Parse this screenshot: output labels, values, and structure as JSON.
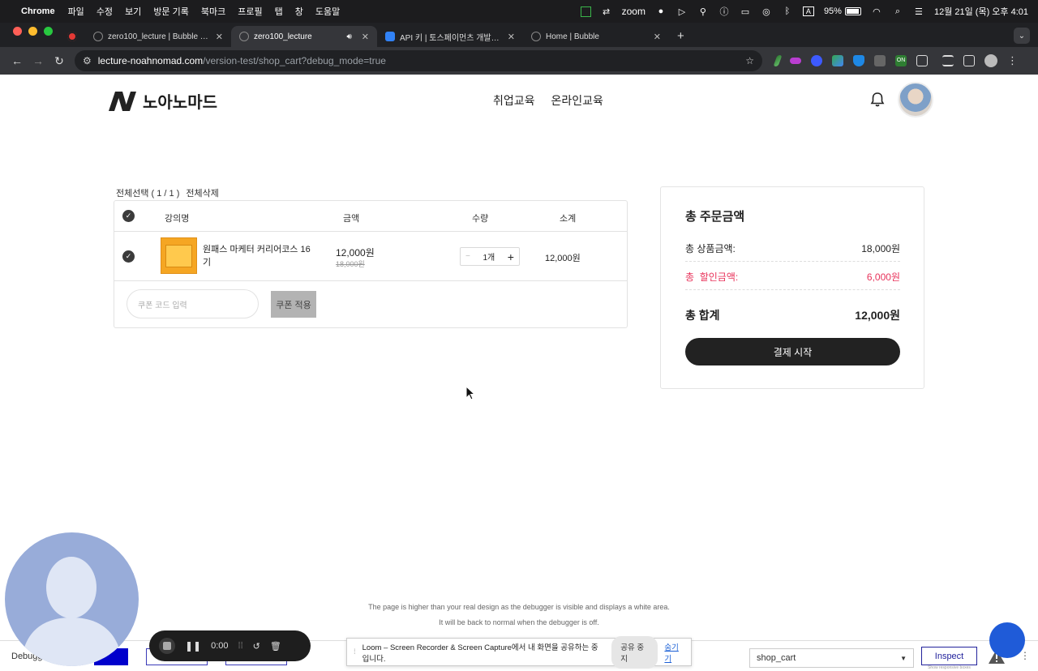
{
  "menubar": {
    "app": "Chrome",
    "items": [
      "파일",
      "수정",
      "보기",
      "방문 기록",
      "북마크",
      "프로필",
      "탭",
      "창",
      "도움말"
    ],
    "zoom_label": "zoom",
    "battery": "95%",
    "datetime": "12월 21일 (목) 오후 4:01"
  },
  "tabs": [
    {
      "title": "zero100_lecture | Bubble Edit",
      "favicon_color": "#555555",
      "active": false
    },
    {
      "title": "zero100_lecture",
      "favicon_color": "#555555",
      "active": true
    },
    {
      "title": "API 키 | 토스페이먼츠 개발자센터",
      "favicon_color": "#3182f6",
      "active": false
    },
    {
      "title": "Home | Bubble",
      "favicon_color": "#555555",
      "active": false
    }
  ],
  "address": {
    "host": "lecture-noahnomad.com",
    "path": "/version-test/shop_cart?debug_mode=true"
  },
  "site": {
    "logo_text": "노아노마드",
    "nav": [
      "취업교육",
      "온라인교육"
    ]
  },
  "cart": {
    "select_all": "전체선택 ( 1 / 1 )",
    "delete_all": "전체삭제",
    "headers": {
      "name": "강의명",
      "price": "금액",
      "qty": "수량",
      "subtotal": "소계"
    },
    "item": {
      "name": "원패스 마케터 커리어코스 16기",
      "price": "12,000원",
      "original_price": "18,000원",
      "qty": "1개",
      "subtotal": "12,000원"
    },
    "coupon_placeholder": "쿠폰 코드 입력",
    "coupon_button": "쿠폰 적용"
  },
  "summary": {
    "title": "총 주문금액",
    "product_label": "총 상품금액:",
    "product_value": "18,000원",
    "discount_label": "총  할인금액:",
    "discount_value": "6,000원",
    "total_label": "총 합계",
    "total_value": "12,000원",
    "pay_button": "결제 시작",
    "discount_color": "#e8325a"
  },
  "debugger": {
    "note1": "The page is higher than your real design as the debugger is visible and displays a white area.",
    "note2": "It will be back to normal when the debugger is off.",
    "label": "Debugg",
    "page_select": "shop_cart",
    "inspect": "Inspect",
    "inspect_sub": "Show responsive boxes"
  },
  "loom": {
    "timer": "0:00",
    "share_text": "Loom – Screen Recorder & Screen Capture에서 내 화면을 공유하는 중입니다.",
    "stop_share": "공유 중지",
    "hide": "숨기기"
  }
}
